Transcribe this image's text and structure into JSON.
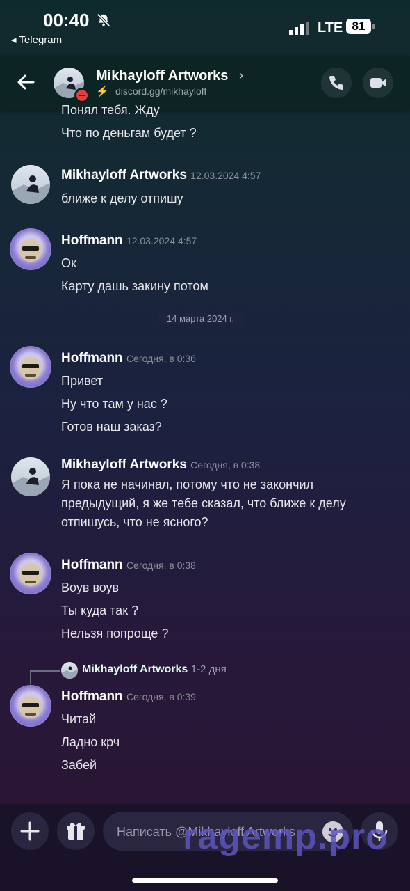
{
  "status": {
    "time": "00:40",
    "back_app": "◂ Telegram",
    "network": "LTE",
    "battery": "81"
  },
  "header": {
    "title": "Mikhayloff Artworks",
    "chevron": "›",
    "subtitle": "discord.gg/mikhayloff"
  },
  "messages": {
    "m0": {
      "text1": "Понял тебя. Жду",
      "text2": "Что по деньгам будет ?"
    },
    "m1": {
      "author": "Mikhayloff Artworks",
      "time": "12.03.2024 4:57",
      "text1": "ближе к делу отпишу"
    },
    "m2": {
      "author": "Hoffmann",
      "time": "12.03.2024 4:57",
      "text1": "Ок",
      "text2": "Карту дашь закину потом"
    },
    "divider": "14 марта 2024 г.",
    "m3": {
      "author": "Hoffmann",
      "time": "Сегодня, в 0:36",
      "text1": "Привет",
      "text2": "Ну что там у нас ?",
      "text3": "Готов наш заказ?"
    },
    "m4": {
      "author": "Mikhayloff Artworks",
      "time": "Сегодня, в 0:38",
      "line1": "Я пока не начинал, потому что не закончил",
      "line2": "предыдущий, я же тебе сказал, что ближе к делу",
      "line3": "отпишусь, что не ясного?"
    },
    "m5": {
      "author": "Hoffmann",
      "time": "Сегодня, в 0:38",
      "text1": "Воув воув",
      "text2": "Ты куда так ?",
      "text3": "Нельзя попроще ?"
    },
    "reply": {
      "author": "Mikhayloff Artworks",
      "text": "1-2 дня"
    },
    "m6": {
      "author": "Hoffmann",
      "time": "Сегодня, в 0:39",
      "text1": "Читай",
      "text2": "Ладно крч",
      "text3": "Забей"
    }
  },
  "composer": {
    "placeholder": "Написать @Mikhayloff Artworks"
  },
  "watermark": "ragemp.pro",
  "colors": {
    "dnd": "#e53e3e",
    "accent": "#8d7fd2",
    "bolt": "#e8c84a"
  }
}
